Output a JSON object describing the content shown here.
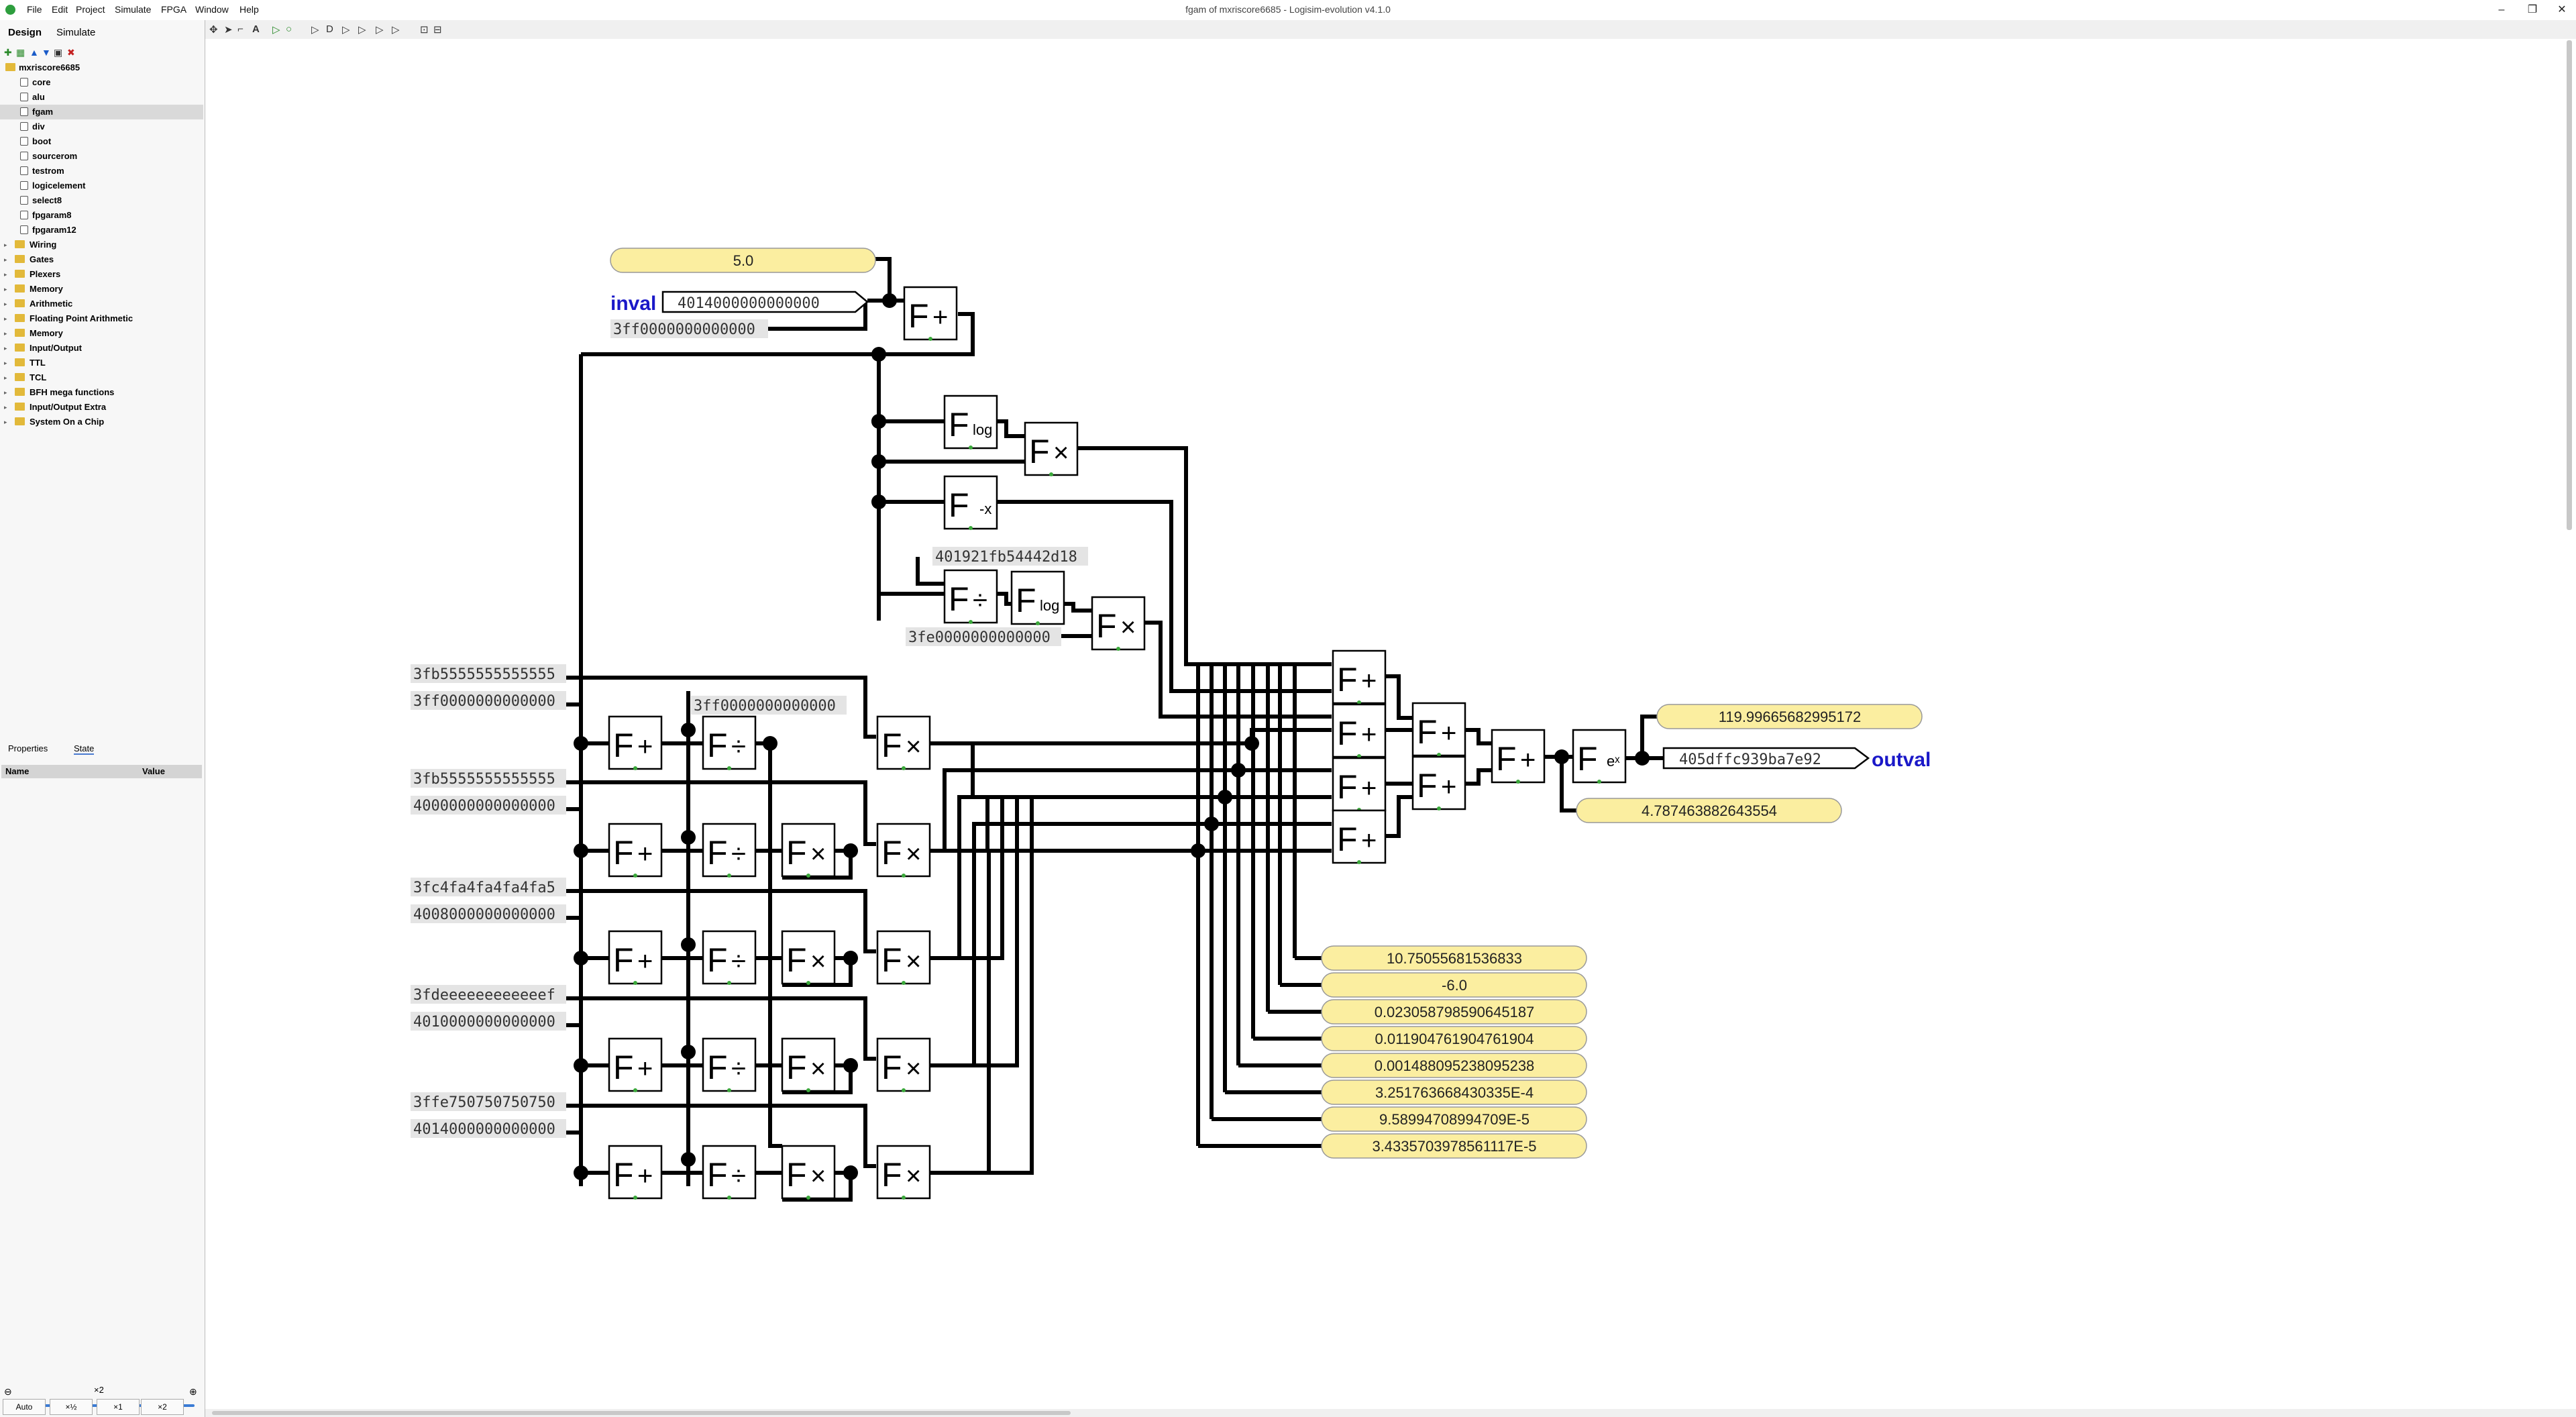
{
  "window": {
    "title": "fgam of mxriscore6685 - Logisim-evolution v4.1.0"
  },
  "menu": {
    "items": [
      "File",
      "Edit",
      "Project",
      "Simulate",
      "FPGA",
      "Window",
      "Help"
    ]
  },
  "left_tabs": {
    "design": "Design",
    "simulate": "Simulate"
  },
  "tree": {
    "project": "mxriscore6685",
    "circuits": [
      "core",
      "alu",
      "fgam",
      "div",
      "boot",
      "sourcerom",
      "testrom",
      "logicelement",
      "select8",
      "fpgaram8",
      "fpgaram12"
    ],
    "selected": "fgam",
    "libraries": [
      "Wiring",
      "Gates",
      "Plexers",
      "Memory",
      "Arithmetic",
      "Floating Point Arithmetic",
      "Memory",
      "Input/Output",
      "TTL",
      "TCL",
      "BFH mega functions",
      "Input/Output Extra",
      "System On a Chip"
    ]
  },
  "props": {
    "tab1": "Properties",
    "tab2": "State",
    "col_name": "Name",
    "col_value": "Value"
  },
  "zoom": {
    "level": "×2",
    "buttons": [
      "Auto",
      "×½",
      "×1",
      "×2"
    ]
  },
  "circuit": {
    "input_label": "inval",
    "input_value": "4014000000000000",
    "output_label": "outval",
    "output_value": "405dffc939ba7e92",
    "constants": {
      "c_five": "5.0",
      "c_3ff_top": "3ff0000000000000",
      "c_2pi": "401921fb54442d18",
      "c_half": "3fe0000000000000",
      "c_3ff_mid": "3ff0000000000000"
    },
    "row_consts": [
      [
        "3fb5555555555555",
        "3ff0000000000000"
      ],
      [
        "3fb5555555555555",
        "4000000000000000"
      ],
      [
        "3fc4fa4fa4fa4fa5",
        "4008000000000000"
      ],
      [
        "3fdeeeeeeeeeeeef",
        "4010000000000000"
      ],
      [
        "3ffe750750750750",
        "4014000000000000"
      ]
    ],
    "probes_top": [
      "119.99665682995172",
      "4.787463882643554"
    ],
    "probes_bottom": [
      "10.75055681536833",
      "-6.0",
      "0.023058798590645187",
      "0.011904761904761904",
      "0.001488095238095238",
      "3.251763668430335E-4",
      "9.58994708994709E-5",
      "3.4335703978561117E-5"
    ]
  }
}
